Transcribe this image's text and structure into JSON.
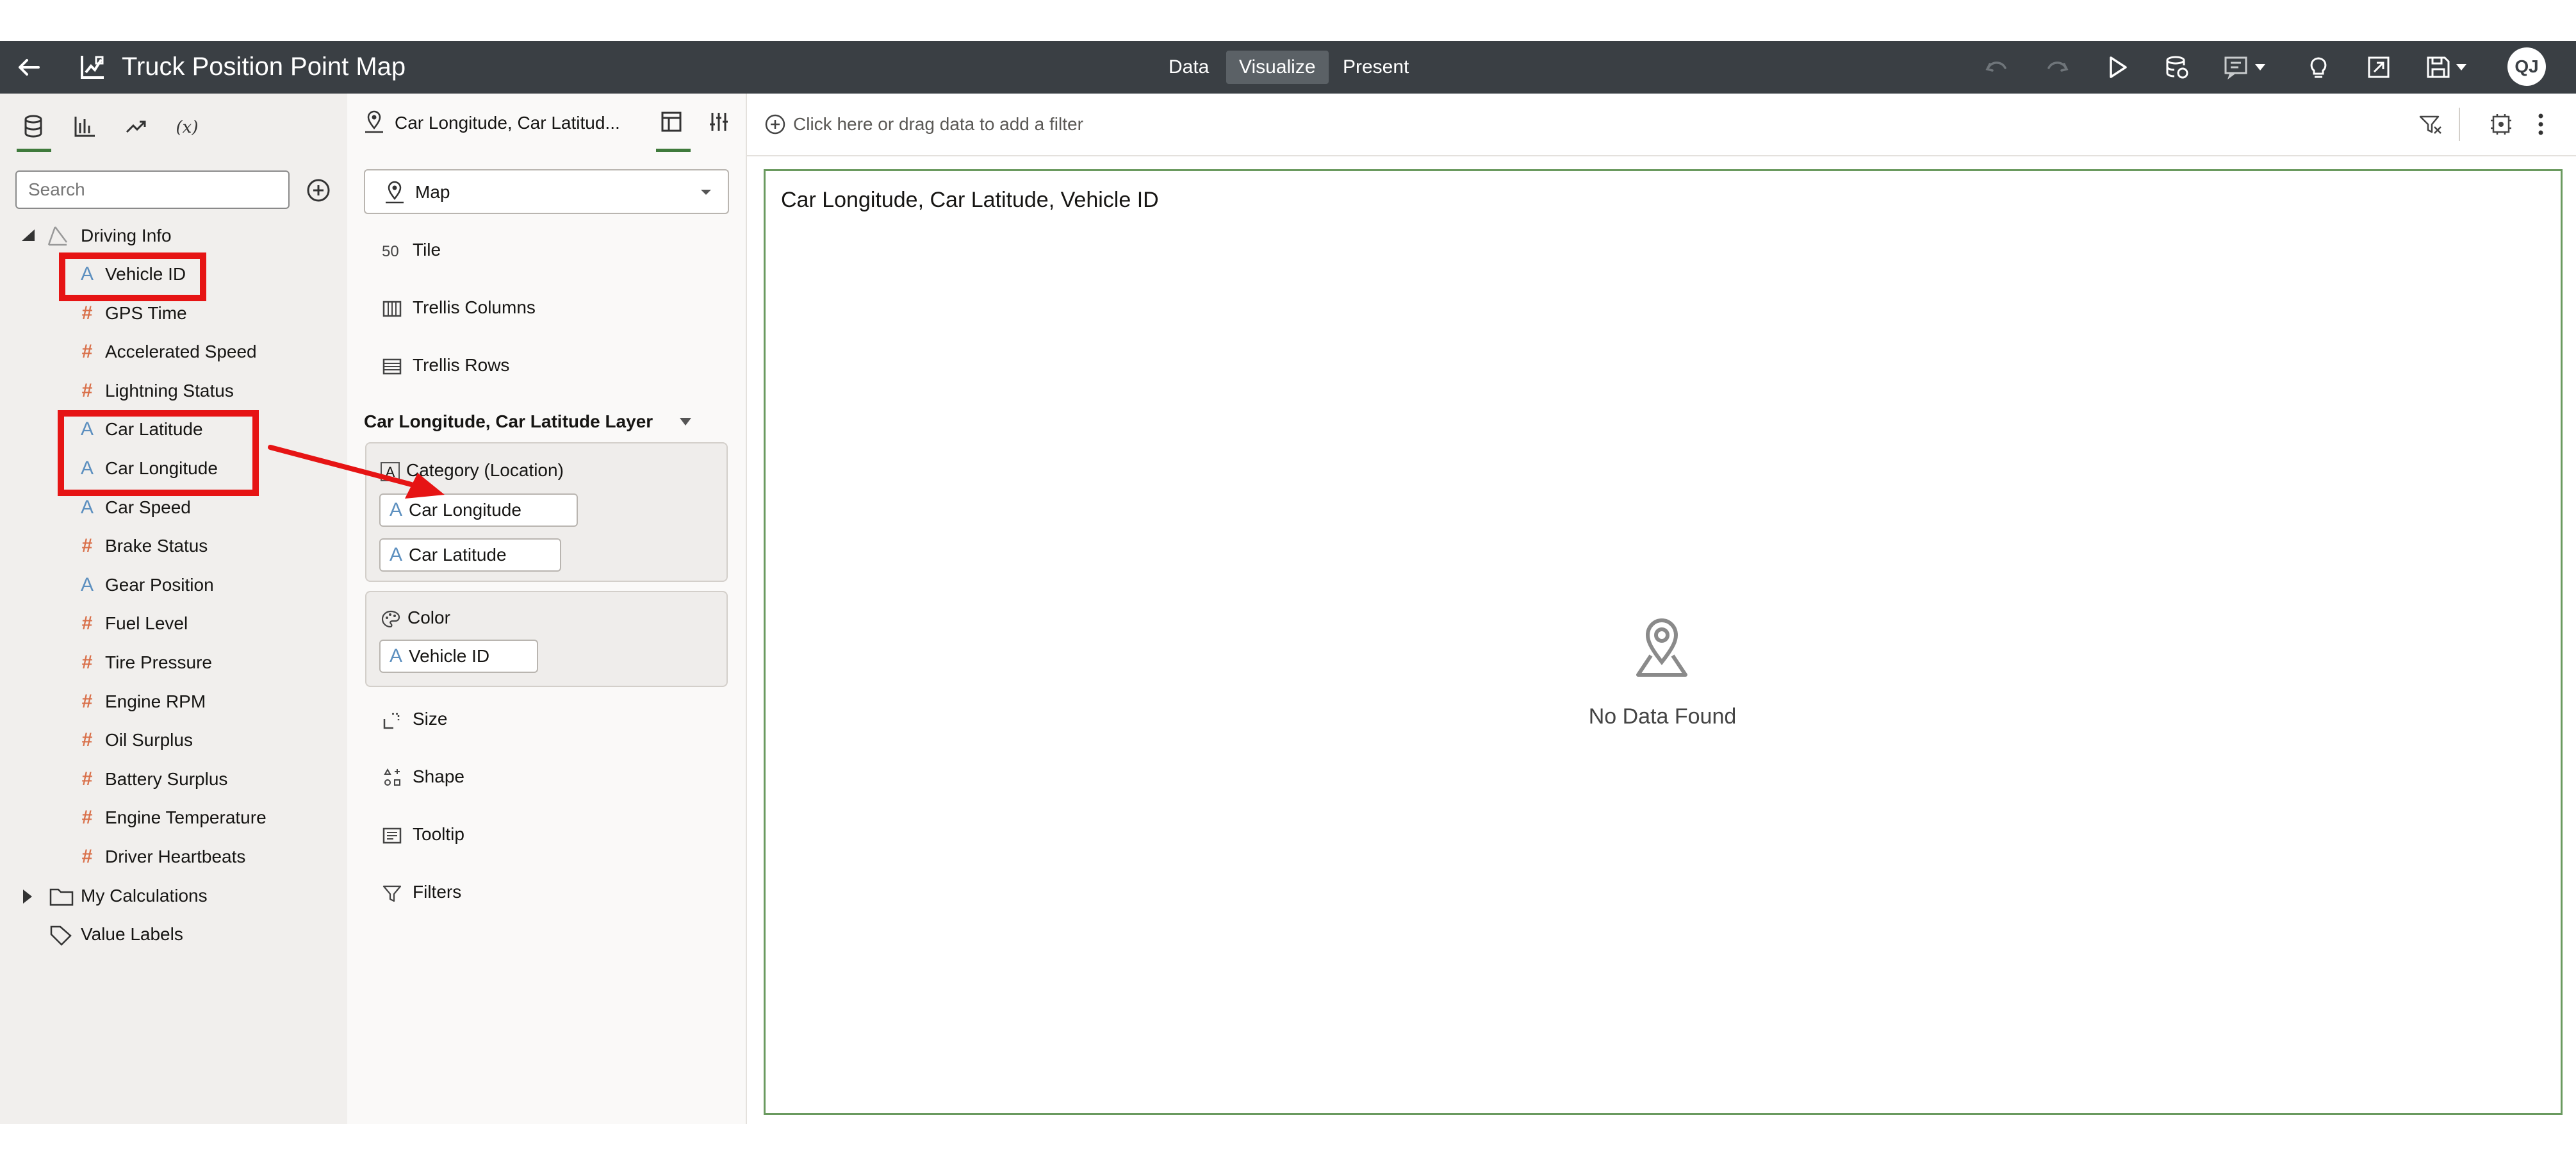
{
  "top_bar": {
    "title": "Truck Position Point Map",
    "tabs": [
      "Data",
      "Visualize",
      "Present"
    ],
    "active_tab": "Visualize",
    "user_initials": "QJ"
  },
  "data_panel": {
    "search_placeholder": "Search",
    "tabs": [
      "data-icon",
      "visualizations-icon",
      "analytics-icon",
      "calculations-icon"
    ],
    "dataset": "Driving Info",
    "columns": [
      {
        "label": "Vehicle ID",
        "type": "attribute"
      },
      {
        "label": "GPS Time",
        "type": "measure"
      },
      {
        "label": "Accelerated Speed",
        "type": "measure"
      },
      {
        "label": "Lightning Status",
        "type": "measure"
      },
      {
        "label": "Car Latitude",
        "type": "attribute"
      },
      {
        "label": "Car Longitude",
        "type": "attribute"
      },
      {
        "label": "Car Speed",
        "type": "attribute"
      },
      {
        "label": "Brake Status",
        "type": "measure"
      },
      {
        "label": "Gear Position",
        "type": "attribute"
      },
      {
        "label": "Fuel Level",
        "type": "measure"
      },
      {
        "label": "Tire Pressure",
        "type": "measure"
      },
      {
        "label": "Engine RPM",
        "type": "measure"
      },
      {
        "label": "Oil Surplus",
        "type": "measure"
      },
      {
        "label": "Battery Surplus",
        "type": "measure"
      },
      {
        "label": "Engine Temperature",
        "type": "measure"
      },
      {
        "label": "Driver Heartbeats",
        "type": "measure"
      }
    ],
    "folders": [
      "My Calculations",
      "Value Labels"
    ]
  },
  "grammar_panel": {
    "header_title": "Car Longitude, Car Latitud...",
    "viz_type": "Map",
    "rows_top": [
      "Tile",
      "Trellis Columns",
      "Trellis Rows"
    ],
    "tile_icon_text": "50",
    "layer_title": "Car Longitude, Car Latitude Layer",
    "category_label": "Category (Location)",
    "category_pills": [
      "Car Longitude",
      "Car Latitude"
    ],
    "color_label": "Color",
    "color_pills": [
      "Vehicle ID"
    ],
    "rows_bottom": [
      "Size",
      "Shape",
      "Tooltip",
      "Filters"
    ]
  },
  "canvas": {
    "filter_placeholder": "Click here or drag data to add a filter",
    "viz_title": "Car Longitude, Car Latitude, Vehicle ID",
    "empty_message": "No Data Found"
  },
  "colors": {
    "topbar": "#3a3f44",
    "accent_green": "#3f7a3c",
    "attribute_icon": "#5c8fbf",
    "measure_icon": "#d9704a",
    "annotation_red": "#e61414"
  }
}
